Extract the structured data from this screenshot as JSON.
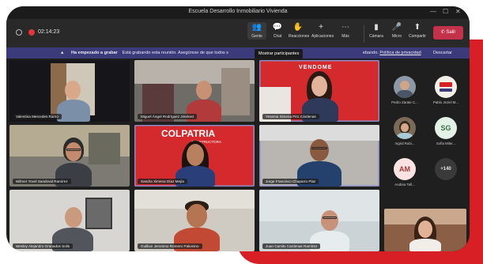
{
  "window": {
    "title": "Escuela Desarrollo Inmobiliario Vivienda"
  },
  "toolbar": {
    "timer": "02:14:23",
    "buttons": [
      {
        "label": "Gente",
        "icon": "people-icon",
        "glyph": "👥",
        "active": true
      },
      {
        "label": "Chat",
        "icon": "chat-icon",
        "glyph": "💬",
        "active": false
      },
      {
        "label": "Reacciones",
        "icon": "reactions-icon",
        "glyph": "✋",
        "active": false
      },
      {
        "label": "Aplicaciones",
        "icon": "apps-icon",
        "glyph": "+",
        "active": false
      },
      {
        "label": "Más",
        "icon": "more-icon",
        "glyph": "⋯",
        "active": false
      },
      {
        "label": "Cámara",
        "icon": "camera-icon",
        "glyph": "▮",
        "active": false
      },
      {
        "label": "Micro",
        "icon": "mic-icon",
        "glyph": "🎤",
        "active": false
      },
      {
        "label": "Compartir",
        "icon": "share-icon",
        "glyph": "⬆",
        "active": false
      }
    ],
    "leave_label": "Salir"
  },
  "banner": {
    "bold": "Ha empezado a grabar",
    "text": "Está grabando esta reunión. Asegúrese de que todos s",
    "tail": "ebando.",
    "link": "Política de privacidad",
    "dismiss": "Descartar"
  },
  "tooltip": "Mostrar participantes",
  "tiles": [
    {
      "name": "Valentina Mercedes Ramo"
    },
    {
      "name": "Miguel Ángel Rodríguez Jiménez"
    },
    {
      "name": "Yesenia Ximena Piro Cárdenas"
    },
    {
      "name": "Wilmer Yovel Sandoval Ramírez"
    },
    {
      "name": "Sandra Ximena Díaz Mejía"
    },
    {
      "name": "Jorge Francisco Chaparro Plaz"
    },
    {
      "name": "Wesley Alejandro Granados Solis"
    },
    {
      "name": "Guillian Jeronimo Romero Palomino"
    },
    {
      "name": "Juan Camilo Cardenas Ramírez"
    }
  ],
  "brands": {
    "colpatria": "COLPATRIA",
    "colpatria_sub": "CONSTRUCTORA",
    "vendome": "VENDOME"
  },
  "sidebar": {
    "participants": [
      {
        "name": "Pedro Zarate C...",
        "initials": "",
        "type": "photo"
      },
      {
        "name": "Pablo Jeziel M...",
        "initials": "",
        "type": "logo"
      },
      {
        "name": "Ingrid Rubi...",
        "initials": "",
        "type": "photo"
      },
      {
        "name": "Sofia Miler...",
        "initials": "SG",
        "type": "initials"
      },
      {
        "name": "Andrea Tell...",
        "initials": "AM",
        "type": "initials"
      },
      {
        "name": "",
        "initials": "+140",
        "type": "more"
      }
    ]
  },
  "colors": {
    "accent_red": "#d81f26",
    "banner": "#3b3a7a",
    "leave": "#c4314b",
    "frame": "#1f1f1f"
  }
}
